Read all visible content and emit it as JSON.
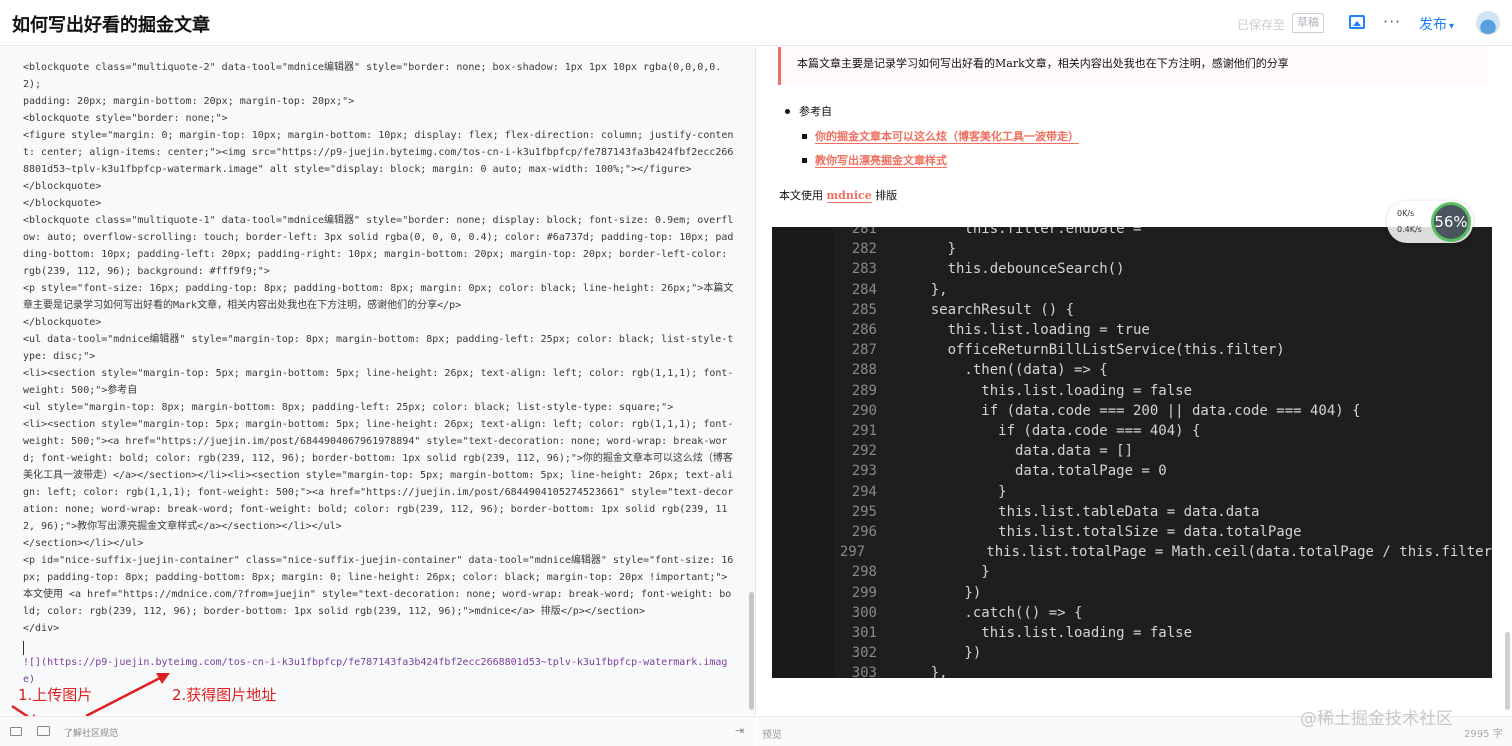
{
  "header": {
    "title": "如何写出好看的掘金文章",
    "save_status": "已保存至",
    "draft_label": "草稿",
    "image_icon": "image-icon",
    "more_label": "···",
    "publish_label": "发布",
    "publish_caret": "▾",
    "avatar_icon": "avatar"
  },
  "editor": {
    "lines": [
      "<blockquote class=\"multiquote-2\" data-tool=\"mdnice编辑器\" style=\"border: none; box-shadow: 1px 1px 10px rgba(0,0,0,0.2);",
      "padding: 20px; margin-bottom: 20px; margin-top: 20px;\">",
      "<blockquote style=\"border: none;\">",
      "<figure style=\"margin: 0; margin-top: 10px; margin-bottom: 10px; display: flex; flex-direction: column; justify-content: center; align-items: center;\"><img src=\"https://p9-juejin.byteimg.com/tos-cn-i-k3u1fbpfcp/fe787143fa3b424fbf2ecc2668801d53~tplv-k3u1fbpfcp-watermark.image\" alt style=\"display: block; margin: 0 auto; max-width: 100%;\"></figure>",
      "</blockquote>",
      "</blockquote>",
      "<blockquote class=\"multiquote-1\" data-tool=\"mdnice编辑器\" style=\"border: none; display: block; font-size: 0.9em; overflow: auto; overflow-scrolling: touch; border-left: 3px solid rgba(0, 0, 0, 0.4); color: #6a737d; padding-top: 10px; padding-bottom: 10px; padding-left: 20px; padding-right: 10px; margin-bottom: 20px; margin-top: 20px; border-left-color: rgb(239, 112, 96); background: #fff9f9;\">",
      "<p style=\"font-size: 16px; padding-top: 8px; padding-bottom: 8px; margin: 0px; color: black; line-height: 26px;\">本篇文章主要是记录学习如何写出好看的Mark文章，相关内容出处我也在下方注明，感谢他们的分享</p>",
      "</blockquote>",
      "<ul data-tool=\"mdnice编辑器\" style=\"margin-top: 8px; margin-bottom: 8px; padding-left: 25px; color: black; list-style-type: disc;\">",
      "<li><section style=\"margin-top: 5px; margin-bottom: 5px; line-height: 26px; text-align: left; color: rgb(1,1,1); font-weight: 500;\">参考自",
      "<ul style=\"margin-top: 8px; margin-bottom: 8px; padding-left: 25px; color: black; list-style-type: square;\">",
      "<li><section style=\"margin-top: 5px; margin-bottom: 5px; line-height: 26px; text-align: left; color: rgb(1,1,1); font-weight: 500;\"><a href=\"https://juejin.im/post/6844904067961978894\" style=\"text-decoration: none; word-wrap: break-word; font-weight: bold; color: rgb(239, 112, 96); border-bottom: 1px solid rgb(239, 112, 96);\">你的掘金文章本可以这么炫（博客美化工具一波带走）</a></section></li><li><section style=\"margin-top: 5px; margin-bottom: 5px; line-height: 26px; text-align: left; color: rgb(1,1,1); font-weight: 500;\"><a href=\"https://juejin.im/post/6844904105274523661\" style=\"text-decoration: none; word-wrap: break-word; font-weight: bold; color: rgb(239, 112, 96); border-bottom: 1px solid rgb(239, 112, 96);\">教你写出漂亮掘金文章样式</a></section></li></ul>",
      "</section></li></ul>",
      "<p id=\"nice-suffix-juejin-container\" class=\"nice-suffix-juejin-container\" data-tool=\"mdnice编辑器\" style=\"font-size: 16px; padding-top: 8px; padding-bottom: 8px; margin: 0; line-height: 26px; color: black; margin-top: 20px !important;\">本文使用 <a href=\"https://mdnice.com/?from=juejin\" style=\"text-decoration: none; word-wrap: break-word; font-weight: bold; color: rgb(239, 112, 96); border-bottom: 1px solid rgb(239, 112, 96);\">mdnice</a> 排版</p></section>",
      "</div>",
      "",
      "![](https://p9-juejin.byteimg.com/tos-cn-i-k3u1fbpfcp/fe787143fa3b424fbf2ecc2668801d53~tplv-k3u1fbpfcp-watermark.image)"
    ]
  },
  "annotations": {
    "step1": "1.上传图片",
    "step2": "2.获得图片地址"
  },
  "editor_footer": {
    "link": "了解社区规范"
  },
  "preview": {
    "quote": "本篇文章主要是记录学习如何写出好看的Mark文章，相关内容出处我也在下方注明，感谢他们的分享",
    "ref_title": "参考自",
    "ref_link1": "你的掘金文章本可以这么炫（博客美化工具一波带走）",
    "ref_link2": "教你写出漂亮掘金文章样式",
    "suffix_pre": "本文使用",
    "suffix_link": "mdnice",
    "suffix_post": "排版",
    "label": "预览",
    "wordcount": "2995 字",
    "watermark": "@稀土掘金技术社区"
  },
  "speed_widget": {
    "up": "0K/s",
    "down": "0.4K/s",
    "percent": "56%"
  },
  "code_screenshot": {
    "lines": [
      {
        "n": "281",
        "code": "        this.filter.endDate ="
      },
      {
        "n": "282",
        "code": "      }"
      },
      {
        "n": "283",
        "code": "      this.debounceSearch()"
      },
      {
        "n": "284",
        "code": "    },"
      },
      {
        "n": "285",
        "code": "    searchResult () {"
      },
      {
        "n": "286",
        "code": "      this.list.loading = true"
      },
      {
        "n": "287",
        "code": "      officeReturnBillListService(this.filter)"
      },
      {
        "n": "288",
        "code": "        .then((data) => {"
      },
      {
        "n": "289",
        "code": "          this.list.loading = false"
      },
      {
        "n": "290",
        "code": "          if (data.code === 200 || data.code === 404) {"
      },
      {
        "n": "291",
        "code": "            if (data.code === 404) {"
      },
      {
        "n": "292",
        "code": "              data.data = []"
      },
      {
        "n": "293",
        "code": "              data.totalPage = 0"
      },
      {
        "n": "294",
        "code": "            }"
      },
      {
        "n": "295",
        "code": "            this.list.tableData = data.data"
      },
      {
        "n": "296",
        "code": "            this.list.totalSize = data.totalPage"
      },
      {
        "n": "297",
        "code": "            this.list.totalPage = Math.ceil(data.totalPage / this.filter"
      },
      {
        "n": "298",
        "code": "          }"
      },
      {
        "n": "299",
        "code": "        })"
      },
      {
        "n": "300",
        "code": "        .catch(() => {"
      },
      {
        "n": "301",
        "code": "          this.list.loading = false"
      },
      {
        "n": "302",
        "code": "        })"
      },
      {
        "n": "303",
        "code": "    },"
      }
    ]
  },
  "colors": {
    "accent": "#1e80ff",
    "link": "#ef7060",
    "annotation": "#e02020"
  }
}
